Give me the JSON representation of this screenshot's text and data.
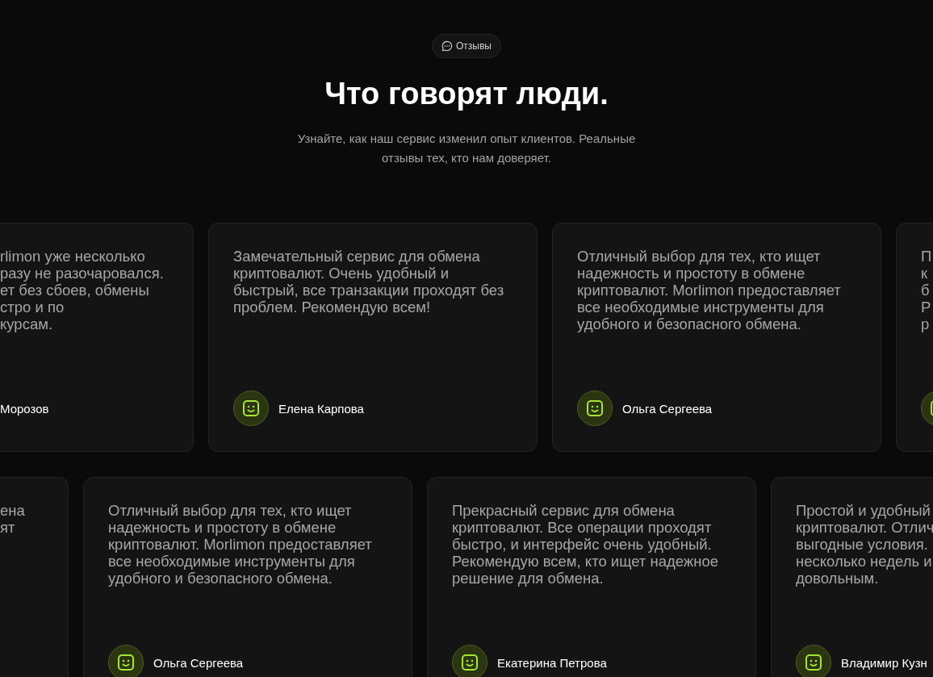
{
  "badge": {
    "label": "Отзывы"
  },
  "title": "Что говорят люди.",
  "subtitle": "Узнайте, как наш сервис изменил опыт клиентов. Реальные отзывы тех, кто нам доверяет.",
  "rows": [
    {
      "reviews": [
        {
          "kind": "cut-left",
          "lines": [
            "rlimon уже несколько",
            "разу не разочаровался.",
            "ет без сбоев, обмены",
            "стро и по",
            "курсам."
          ],
          "author": "Морозов"
        },
        {
          "kind": "full",
          "text": "Замечательный сервис для обмена криптовалют. Очень удобный и быстрый, все транзакции проходят без проблем. Рекомендую всем!",
          "author": "Елена Карпова"
        },
        {
          "kind": "full",
          "text": "Отличный выбор для тех, кто ищет надежность и простоту в обмене криптовалют. Morlimon предоставляет все необходимые инструменты для удобного и безопасного обмена.",
          "author": "Ольга Сергеева"
        },
        {
          "kind": "cut-right",
          "lines": [
            "П",
            "к",
            "б",
            "Р",
            "р"
          ]
        }
      ]
    },
    {
      "reviews": [
        {
          "kind": "cut-left",
          "lines": [
            "ена",
            "ят"
          ]
        },
        {
          "kind": "full",
          "text": "Отличный выбор для тех, кто ищет надежность и простоту в обмене криптовалют. Morlimon предоставляет все необходимые инструменты для удобного и безопасного обмена.",
          "author": "Ольга Сергеева"
        },
        {
          "kind": "full",
          "text": "Прекрасный сервис для обмена криптовалют. Все операции проходят быстро, и интерфейс очень удобный. Рекомендую всем, кто ищет надежное решение для обмена.",
          "author": "Екатерина Петрова"
        },
        {
          "kind": "cut-right",
          "lines": [
            "Простой и удобный",
            "криптовалют. Отлич",
            "выгодные условия.",
            "несколько недель и",
            "довольным."
          ],
          "author": "Владимир Кузн"
        }
      ]
    }
  ]
}
